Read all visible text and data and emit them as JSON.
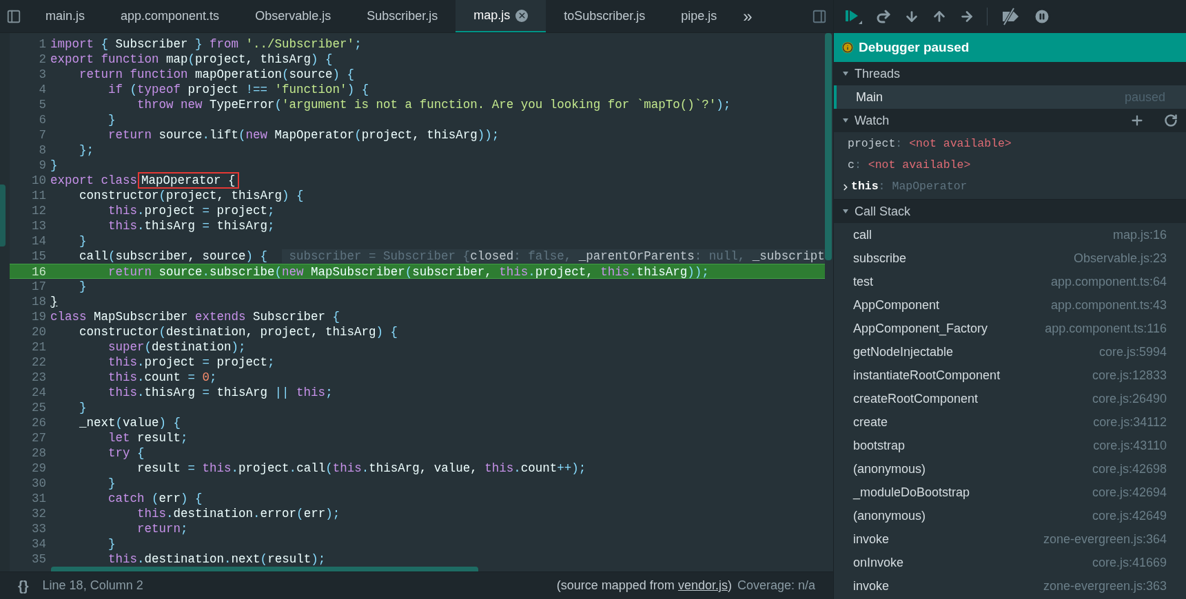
{
  "tabs": [
    {
      "label": "main.js",
      "selected": false
    },
    {
      "label": "app.component.ts",
      "selected": false
    },
    {
      "label": "Observable.js",
      "selected": false
    },
    {
      "label": "Subscriber.js",
      "selected": false
    },
    {
      "label": "map.js",
      "selected": true
    },
    {
      "label": "toSubscriber.js",
      "selected": false
    },
    {
      "label": "pipe.js",
      "selected": false
    }
  ],
  "tabs_overflow": "»",
  "code_lines": [
    {
      "number": "1",
      "current": false,
      "tokens": [
        {
          "kind": "keyword",
          "text": "import "
        },
        {
          "kind": "punct",
          "text": "{"
        },
        {
          "kind": "plain",
          "text": " Subscriber "
        },
        {
          "kind": "punct",
          "text": "} "
        },
        {
          "kind": "keyword",
          "text": "from "
        },
        {
          "kind": "string",
          "text": "'../Subscriber'"
        },
        {
          "kind": "punct",
          "text": ";"
        }
      ]
    },
    {
      "number": "2",
      "current": false,
      "tokens": [
        {
          "kind": "keyword",
          "text": "export function"
        },
        {
          "kind": "plain",
          "text": " map"
        },
        {
          "kind": "punct",
          "text": "("
        },
        {
          "kind": "plain",
          "text": "project, thisArg"
        },
        {
          "kind": "punct",
          "text": ") {"
        }
      ]
    },
    {
      "number": "3",
      "current": false,
      "tokens": [
        {
          "kind": "keyword",
          "text": "    return function"
        },
        {
          "kind": "plain",
          "text": " mapOperation"
        },
        {
          "kind": "punct",
          "text": "("
        },
        {
          "kind": "plain",
          "text": "source"
        },
        {
          "kind": "punct",
          "text": ") {"
        }
      ]
    },
    {
      "number": "4",
      "current": false,
      "tokens": [
        {
          "kind": "keyword",
          "text": "        if "
        },
        {
          "kind": "punct",
          "text": "("
        },
        {
          "kind": "keyword",
          "text": "typeof"
        },
        {
          "kind": "plain",
          "text": " project "
        },
        {
          "kind": "punct",
          "text": "!== "
        },
        {
          "kind": "string",
          "text": "'function'"
        },
        {
          "kind": "punct",
          "text": ") {"
        }
      ]
    },
    {
      "number": "5",
      "current": false,
      "tokens": [
        {
          "kind": "keyword",
          "text": "            throw new"
        },
        {
          "kind": "plain",
          "text": " TypeError"
        },
        {
          "kind": "punct",
          "text": "("
        },
        {
          "kind": "string",
          "text": "'argument is not a function. Are you looking for `mapTo()`?'"
        },
        {
          "kind": "punct",
          "text": ");"
        }
      ]
    },
    {
      "number": "6",
      "current": false,
      "tokens": [
        {
          "kind": "punct",
          "text": "        }"
        }
      ]
    },
    {
      "number": "7",
      "current": false,
      "tokens": [
        {
          "kind": "keyword",
          "text": "        return"
        },
        {
          "kind": "plain",
          "text": " source"
        },
        {
          "kind": "punct",
          "text": "."
        },
        {
          "kind": "plain",
          "text": "lift"
        },
        {
          "kind": "punct",
          "text": "("
        },
        {
          "kind": "keyword",
          "text": "new"
        },
        {
          "kind": "plain",
          "text": " MapOperator"
        },
        {
          "kind": "punct",
          "text": "("
        },
        {
          "kind": "plain",
          "text": "project, thisArg"
        },
        {
          "kind": "punct",
          "text": "));"
        }
      ]
    },
    {
      "number": "8",
      "current": false,
      "tokens": [
        {
          "kind": "punct",
          "text": "    };"
        }
      ]
    },
    {
      "number": "9",
      "current": false,
      "tokens": [
        {
          "kind": "punct",
          "text": "}"
        }
      ]
    },
    {
      "number": "10",
      "current": false,
      "tokens": [
        {
          "kind": "keyword",
          "text": "export class"
        },
        {
          "kind": "boxed",
          "text": "MapOperator {"
        }
      ]
    },
    {
      "number": "11",
      "current": false,
      "tokens": [
        {
          "kind": "plain",
          "text": "    constructor"
        },
        {
          "kind": "punct",
          "text": "("
        },
        {
          "kind": "plain",
          "text": "project, thisArg"
        },
        {
          "kind": "punct",
          "text": ") {"
        }
      ]
    },
    {
      "number": "12",
      "current": false,
      "tokens": [
        {
          "kind": "keyword",
          "text": "        this"
        },
        {
          "kind": "punct",
          "text": "."
        },
        {
          "kind": "plain",
          "text": "project "
        },
        {
          "kind": "punct",
          "text": "="
        },
        {
          "kind": "plain",
          "text": " project"
        },
        {
          "kind": "punct",
          "text": ";"
        }
      ]
    },
    {
      "number": "13",
      "current": false,
      "tokens": [
        {
          "kind": "keyword",
          "text": "        this"
        },
        {
          "kind": "punct",
          "text": "."
        },
        {
          "kind": "plain",
          "text": "thisArg "
        },
        {
          "kind": "punct",
          "text": "="
        },
        {
          "kind": "plain",
          "text": " thisArg"
        },
        {
          "kind": "punct",
          "text": ";"
        }
      ]
    },
    {
      "number": "14",
      "current": false,
      "tokens": [
        {
          "kind": "punct",
          "text": "    }"
        }
      ]
    },
    {
      "number": "15",
      "current": false,
      "tokens": [
        {
          "kind": "plain",
          "text": "    call"
        },
        {
          "kind": "punct",
          "text": "("
        },
        {
          "kind": "plain",
          "text": "subscriber, source"
        },
        {
          "kind": "punct",
          "text": ") {  "
        },
        {
          "kind": "hint",
          "text": " subscriber = Subscriber {"
        },
        {
          "kind": "hint_key",
          "text": "closed"
        },
        {
          "kind": "hint",
          "text": ": false, "
        },
        {
          "kind": "hint_key",
          "text": "_parentOrParents"
        },
        {
          "kind": "hint",
          "text": ": null, "
        },
        {
          "kind": "hint_key",
          "text": "_subscript"
        }
      ]
    },
    {
      "number": "16",
      "current": true,
      "tokens": [
        {
          "kind": "keyword",
          "text": "        return"
        },
        {
          "kind": "plain",
          "text": " source"
        },
        {
          "kind": "punct",
          "text": "."
        },
        {
          "kind": "plain",
          "text": "subscribe"
        },
        {
          "kind": "punct",
          "text": "("
        },
        {
          "kind": "keyword",
          "text": "new"
        },
        {
          "kind": "plain",
          "text": " MapSubscriber"
        },
        {
          "kind": "punct",
          "text": "("
        },
        {
          "kind": "plain",
          "text": "subscriber, "
        },
        {
          "kind": "keyword",
          "text": "this"
        },
        {
          "kind": "punct",
          "text": "."
        },
        {
          "kind": "plain",
          "text": "project, "
        },
        {
          "kind": "keyword",
          "text": "this"
        },
        {
          "kind": "punct",
          "text": "."
        },
        {
          "kind": "plain",
          "text": "thisArg"
        },
        {
          "kind": "punct",
          "text": "));"
        }
      ]
    },
    {
      "number": "17",
      "current": false,
      "tokens": [
        {
          "kind": "punct",
          "text": "    }"
        }
      ]
    },
    {
      "number": "18",
      "current": false,
      "tokens": [
        {
          "kind": "underlined",
          "text": "}"
        }
      ]
    },
    {
      "number": "19",
      "current": false,
      "tokens": [
        {
          "kind": "keyword",
          "text": "class"
        },
        {
          "kind": "plain",
          "text": " MapSubscriber "
        },
        {
          "kind": "keyword",
          "text": "extends"
        },
        {
          "kind": "plain",
          "text": " Subscriber "
        },
        {
          "kind": "punct",
          "text": "{"
        }
      ]
    },
    {
      "number": "20",
      "current": false,
      "tokens": [
        {
          "kind": "plain",
          "text": "    constructor"
        },
        {
          "kind": "punct",
          "text": "("
        },
        {
          "kind": "plain",
          "text": "destination, project, thisArg"
        },
        {
          "kind": "punct",
          "text": ") {"
        }
      ]
    },
    {
      "number": "21",
      "current": false,
      "tokens": [
        {
          "kind": "keyword",
          "text": "        super"
        },
        {
          "kind": "punct",
          "text": "("
        },
        {
          "kind": "plain",
          "text": "destination"
        },
        {
          "kind": "punct",
          "text": ");"
        }
      ]
    },
    {
      "number": "22",
      "current": false,
      "tokens": [
        {
          "kind": "keyword",
          "text": "        this"
        },
        {
          "kind": "punct",
          "text": "."
        },
        {
          "kind": "plain",
          "text": "project "
        },
        {
          "kind": "punct",
          "text": "="
        },
        {
          "kind": "plain",
          "text": " project"
        },
        {
          "kind": "punct",
          "text": ";"
        }
      ]
    },
    {
      "number": "23",
      "current": false,
      "tokens": [
        {
          "kind": "keyword",
          "text": "        this"
        },
        {
          "kind": "punct",
          "text": "."
        },
        {
          "kind": "plain",
          "text": "count "
        },
        {
          "kind": "punct",
          "text": "= "
        },
        {
          "kind": "number",
          "text": "0"
        },
        {
          "kind": "punct",
          "text": ";"
        }
      ]
    },
    {
      "number": "24",
      "current": false,
      "tokens": [
        {
          "kind": "keyword",
          "text": "        this"
        },
        {
          "kind": "punct",
          "text": "."
        },
        {
          "kind": "plain",
          "text": "thisArg "
        },
        {
          "kind": "punct",
          "text": "="
        },
        {
          "kind": "plain",
          "text": " thisArg "
        },
        {
          "kind": "punct",
          "text": "|| "
        },
        {
          "kind": "keyword",
          "text": "this"
        },
        {
          "kind": "punct",
          "text": ";"
        }
      ]
    },
    {
      "number": "25",
      "current": false,
      "tokens": [
        {
          "kind": "punct",
          "text": "    }"
        }
      ]
    },
    {
      "number": "26",
      "current": false,
      "tokens": [
        {
          "kind": "plain",
          "text": "    _next"
        },
        {
          "kind": "punct",
          "text": "("
        },
        {
          "kind": "plain",
          "text": "value"
        },
        {
          "kind": "punct",
          "text": ") {"
        }
      ]
    },
    {
      "number": "27",
      "current": false,
      "tokens": [
        {
          "kind": "keyword",
          "text": "        let"
        },
        {
          "kind": "plain",
          "text": " result"
        },
        {
          "kind": "punct",
          "text": ";"
        }
      ]
    },
    {
      "number": "28",
      "current": false,
      "tokens": [
        {
          "kind": "keyword",
          "text": "        try"
        },
        {
          "kind": "punct",
          "text": " {"
        }
      ]
    },
    {
      "number": "29",
      "current": false,
      "tokens": [
        {
          "kind": "plain",
          "text": "            result "
        },
        {
          "kind": "punct",
          "text": "= "
        },
        {
          "kind": "keyword",
          "text": "this"
        },
        {
          "kind": "punct",
          "text": "."
        },
        {
          "kind": "plain",
          "text": "project"
        },
        {
          "kind": "punct",
          "text": "."
        },
        {
          "kind": "plain",
          "text": "call"
        },
        {
          "kind": "punct",
          "text": "("
        },
        {
          "kind": "keyword",
          "text": "this"
        },
        {
          "kind": "punct",
          "text": "."
        },
        {
          "kind": "plain",
          "text": "thisArg, value, "
        },
        {
          "kind": "keyword",
          "text": "this"
        },
        {
          "kind": "punct",
          "text": "."
        },
        {
          "kind": "plain",
          "text": "count"
        },
        {
          "kind": "punct",
          "text": "++);"
        }
      ]
    },
    {
      "number": "30",
      "current": false,
      "tokens": [
        {
          "kind": "punct",
          "text": "        }"
        }
      ]
    },
    {
      "number": "31",
      "current": false,
      "tokens": [
        {
          "kind": "keyword",
          "text": "        catch"
        },
        {
          "kind": "punct",
          "text": " ("
        },
        {
          "kind": "plain",
          "text": "err"
        },
        {
          "kind": "punct",
          "text": ") {"
        }
      ]
    },
    {
      "number": "32",
      "current": false,
      "tokens": [
        {
          "kind": "keyword",
          "text": "            this"
        },
        {
          "kind": "punct",
          "text": "."
        },
        {
          "kind": "plain",
          "text": "destination"
        },
        {
          "kind": "punct",
          "text": "."
        },
        {
          "kind": "plain",
          "text": "error"
        },
        {
          "kind": "punct",
          "text": "("
        },
        {
          "kind": "plain",
          "text": "err"
        },
        {
          "kind": "punct",
          "text": ");"
        }
      ]
    },
    {
      "number": "33",
      "current": false,
      "tokens": [
        {
          "kind": "keyword",
          "text": "            return"
        },
        {
          "kind": "punct",
          "text": ";"
        }
      ]
    },
    {
      "number": "34",
      "current": false,
      "tokens": [
        {
          "kind": "punct",
          "text": "        }"
        }
      ]
    },
    {
      "number": "35",
      "current": false,
      "tokens": [
        {
          "kind": "keyword",
          "text": "        this"
        },
        {
          "kind": "punct",
          "text": "."
        },
        {
          "kind": "plain",
          "text": "destination"
        },
        {
          "kind": "punct",
          "text": "."
        },
        {
          "kind": "plain",
          "text": "next"
        },
        {
          "kind": "punct",
          "text": "("
        },
        {
          "kind": "plain",
          "text": "result"
        },
        {
          "kind": "punct",
          "text": ");"
        }
      ]
    }
  ],
  "status_bar": {
    "braces": "{}",
    "position": "Line 18, Column 2",
    "source_prefix": "(source mapped from ",
    "source_link": "vendor.js",
    "source_suffix": ")",
    "coverage": "Coverage: n/a"
  },
  "debugger": {
    "banner": "Debugger paused",
    "threads": {
      "title": "Threads",
      "expanded": true,
      "items": [
        {
          "name": "Main",
          "state": "paused",
          "selected": true
        }
      ]
    },
    "watch": {
      "title": "Watch",
      "expanded": true,
      "items": [
        {
          "name": "project",
          "separator": ":",
          "value": "<not available>",
          "kind": "error",
          "expandable": false
        },
        {
          "name": "c",
          "separator": ":",
          "value": "<not available>",
          "kind": "error",
          "expandable": false
        },
        {
          "name": "this",
          "separator": ":",
          "value": "MapOperator",
          "kind": "object",
          "expandable": true
        }
      ]
    },
    "call_stack": {
      "title": "Call Stack",
      "expanded": true,
      "frames": [
        {
          "name": "call",
          "location": "map.js:16"
        },
        {
          "name": "subscribe",
          "location": "Observable.js:23"
        },
        {
          "name": "test",
          "location": "app.component.ts:64"
        },
        {
          "name": "AppComponent",
          "location": "app.component.ts:43"
        },
        {
          "name": "AppComponent_Factory",
          "location": "app.component.ts:116"
        },
        {
          "name": "getNodeInjectable",
          "location": "core.js:5994"
        },
        {
          "name": "instantiateRootComponent",
          "location": "core.js:12833"
        },
        {
          "name": "createRootComponent",
          "location": "core.js:26490"
        },
        {
          "name": "create",
          "location": "core.js:34112"
        },
        {
          "name": "bootstrap",
          "location": "core.js:43110"
        },
        {
          "name": "(anonymous)",
          "location": "core.js:42698"
        },
        {
          "name": "_moduleDoBootstrap",
          "location": "core.js:42694"
        },
        {
          "name": "(anonymous)",
          "location": "core.js:42649"
        },
        {
          "name": "invoke",
          "location": "zone-evergreen.js:364"
        },
        {
          "name": "onInvoke",
          "location": "core.js:41669"
        },
        {
          "name": "invoke",
          "location": "zone-evergreen.js:363"
        }
      ]
    }
  }
}
